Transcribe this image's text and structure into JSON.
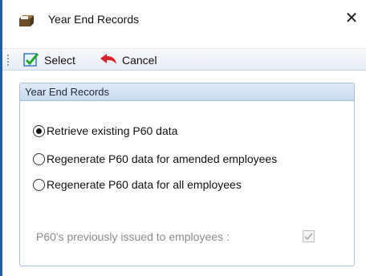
{
  "window": {
    "title": "Year End Records",
    "icons": {
      "app": "file-box-icon",
      "close": "close-icon"
    },
    "close_glyph": "✕"
  },
  "toolbar": {
    "select_label": "Select",
    "cancel_label": "Cancel",
    "icons": {
      "select": "green-check-icon",
      "cancel": "red-back-arrow-icon"
    }
  },
  "group": {
    "header": "Year End Records",
    "options": [
      {
        "label": "Retrieve existing P60 data",
        "selected": true
      },
      {
        "label": "Regenerate P60 data for amended employees",
        "selected": false
      },
      {
        "label": "Regenerate P60 data for all employees",
        "selected": false
      }
    ],
    "issued_label": "P60's previously issued to employees :",
    "issued_checked": true,
    "issued_enabled": false
  },
  "colors": {
    "accent": "#1f5fa8",
    "group_border": "#a9c0de",
    "disabled_text": "#8c8c8c"
  }
}
